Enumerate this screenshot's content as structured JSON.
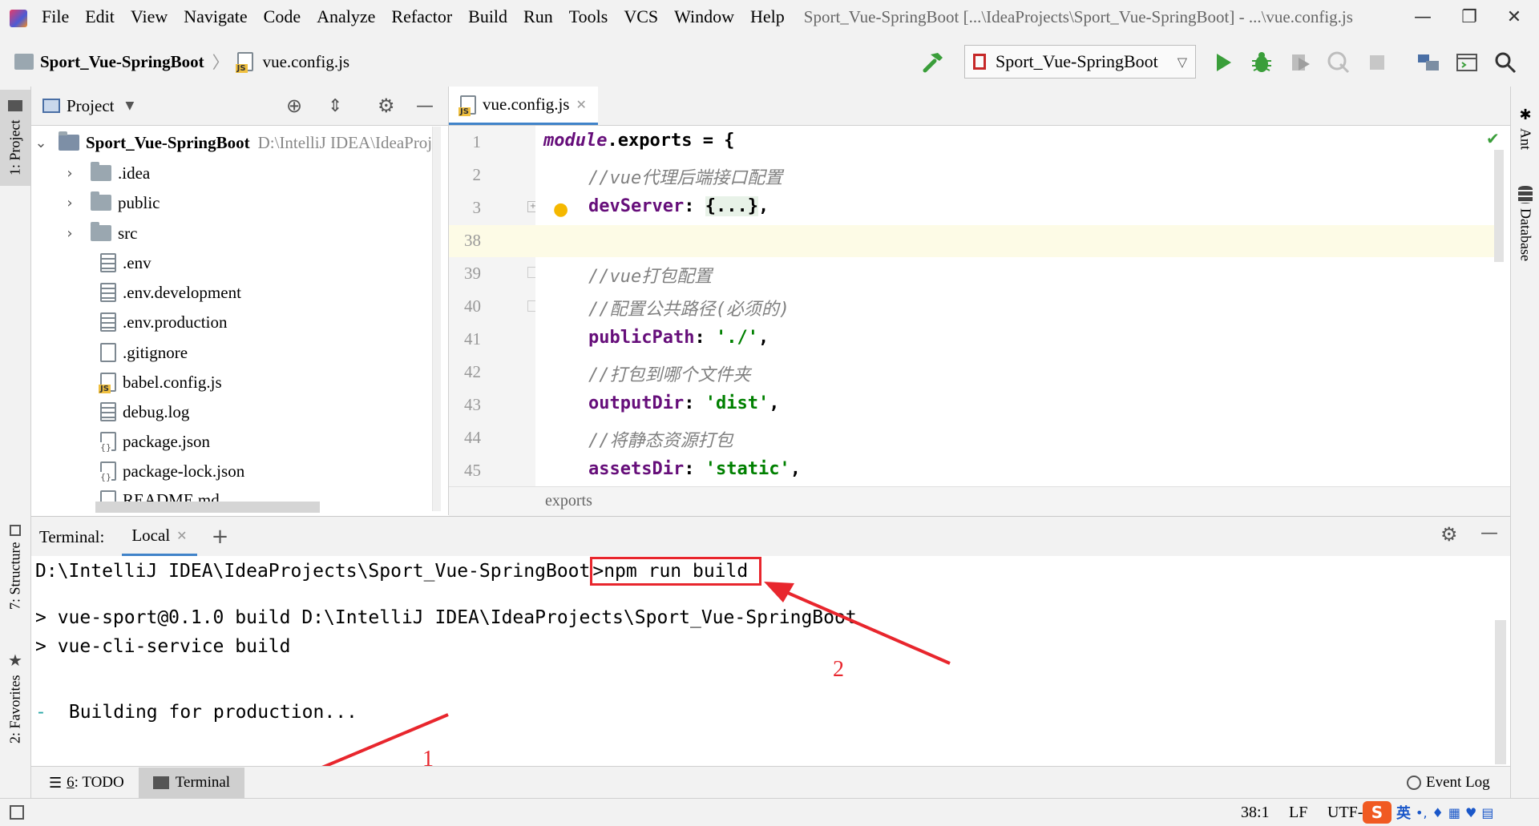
{
  "window": {
    "title": "Sport_Vue-SpringBoot [...\\IdeaProjects\\Sport_Vue-SpringBoot] - ...\\vue.config.js",
    "minimize": "—",
    "restore": "❐",
    "close": "✕"
  },
  "menu": [
    "File",
    "Edit",
    "View",
    "Navigate",
    "Code",
    "Analyze",
    "Refactor",
    "Build",
    "Run",
    "Tools",
    "VCS",
    "Window",
    "Help"
  ],
  "nav": {
    "project": "Sport_Vue-SpringBoot",
    "file": "vue.config.js",
    "run_config": "Sport_Vue-SpringBoot"
  },
  "left_strip": {
    "project_tab": "1: Project",
    "structure_tab": "7: Structure",
    "favorites_tab": "2: Favorites"
  },
  "right_strip": {
    "ant_tab": "Ant",
    "database_tab": "Database"
  },
  "project_panel": {
    "title": "Project",
    "root_name": "Sport_Vue-SpringBoot",
    "root_path": "D:\\IntelliJ IDEA\\IdeaProj",
    "items": [
      {
        "name": ".idea",
        "kind": "folder"
      },
      {
        "name": "public",
        "kind": "folder"
      },
      {
        "name": "src",
        "kind": "folder"
      },
      {
        "name": ".env",
        "kind": "text"
      },
      {
        "name": ".env.development",
        "kind": "text"
      },
      {
        "name": ".env.production",
        "kind": "text"
      },
      {
        "name": ".gitignore",
        "kind": "ignore"
      },
      {
        "name": "babel.config.js",
        "kind": "js"
      },
      {
        "name": "debug.log",
        "kind": "text"
      },
      {
        "name": "package.json",
        "kind": "json"
      },
      {
        "name": "package-lock.json",
        "kind": "json"
      },
      {
        "name": "README.md",
        "kind": "md"
      }
    ]
  },
  "editor": {
    "tab_label": "vue.config.js",
    "line_numbers": [
      "1",
      "2",
      "3",
      "38",
      "39",
      "40",
      "41",
      "42",
      "43",
      "44",
      "45"
    ],
    "lines": {
      "l1_kw": "module",
      "l1_rest": ".exports = {",
      "l2": "//vue代理后端接口配置",
      "l3_prop": "devServer",
      "l3_rest": ": ",
      "l3_fold": "{...}",
      "l3_end": ",",
      "l39": "//vue打包配置",
      "l40": "//配置公共路径(必须的)",
      "l41_prop": "publicPath",
      "l41_str": "'./'",
      "l42": "//打包到哪个文件夹",
      "l43_prop": "outputDir",
      "l43_str": "'dist'",
      "l44": "//将静态资源打包",
      "l45_prop": "assetsDir",
      "l45_str": "'static'",
      "sep": ": ",
      "comma": ","
    },
    "breadcrumb": "exports"
  },
  "terminal": {
    "label": "Terminal:",
    "tab": "Local",
    "add": "+",
    "prompt": "D:\\IntelliJ IDEA\\IdeaProjects\\Sport_Vue-SpringBoot",
    "command": ">npm run build",
    "out1": "> vue-sport@0.1.0 build D:\\IntelliJ IDEA\\IdeaProjects\\Sport_Vue-SpringBoot",
    "out2": "> vue-cli-service build",
    "spinner": "-",
    "out3": "Building for production..."
  },
  "annotations": {
    "one": "1",
    "two": "2"
  },
  "bottom_tabs": {
    "todo_num": "6",
    "todo": ": TODO",
    "terminal": "Terminal",
    "event_log": "Event Log"
  },
  "status": {
    "position": "38:1",
    "line_sep": "LF",
    "encoding": "UTF-",
    "ime_lang": "英"
  },
  "colors": {
    "accent_red": "#e8262d",
    "run_green": "#3a9e3a",
    "keyword_purple": "#660e7a",
    "string_green": "#008000"
  }
}
